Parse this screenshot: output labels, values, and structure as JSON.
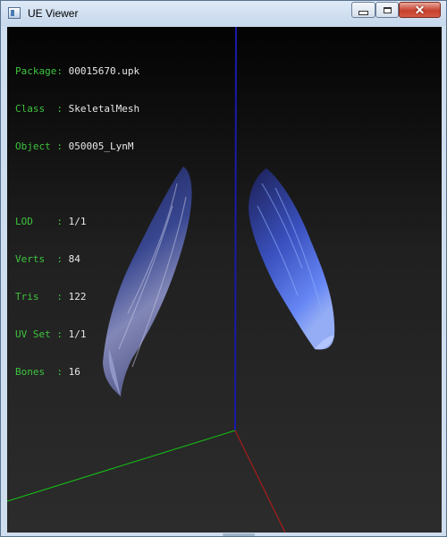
{
  "window": {
    "title": "UE Viewer"
  },
  "hud": {
    "package_label": "Package:",
    "package_value": "00015670.upk",
    "class_label": "Class  :",
    "class_value": "SkeletalMesh",
    "object_label": "Object :",
    "object_value": "050005_LynM",
    "lod_label": "LOD    :",
    "lod_value": "1/1",
    "verts_label": "Verts  :",
    "verts_value": "84",
    "tris_label": "Tris   :",
    "tris_value": "122",
    "uv_label": "UV Set :",
    "uv_value": "1/1",
    "bones_label": "Bones  :",
    "bones_value": "16"
  },
  "colors": {
    "label": "#3ec43e",
    "value": "#e8e8e8",
    "axis_x": "#c01818",
    "axis_y": "#14c814",
    "axis_z": "#1a1aa8"
  }
}
